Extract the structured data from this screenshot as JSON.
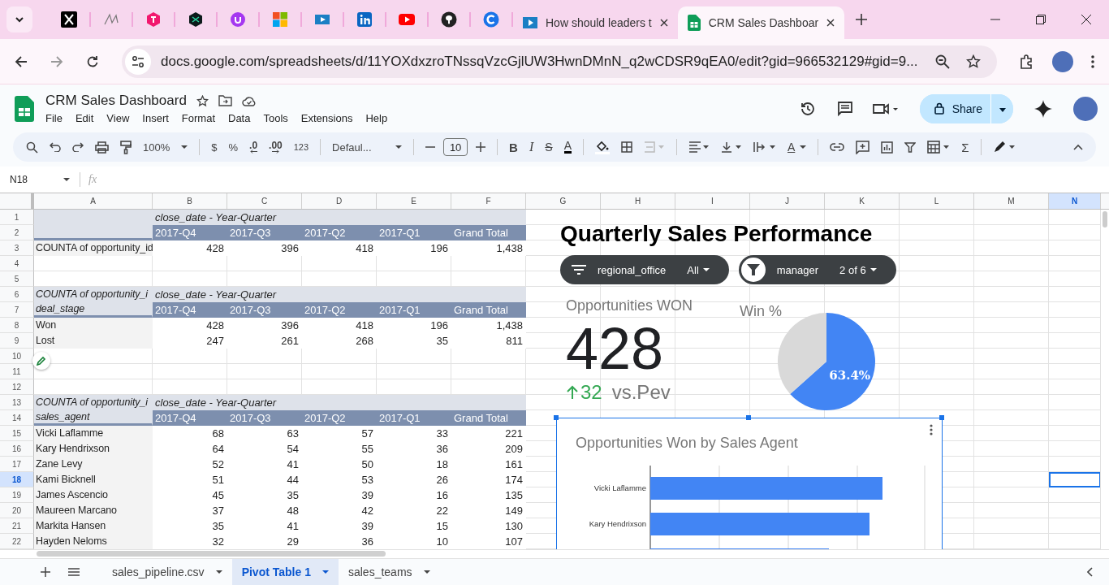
{
  "browser": {
    "tabs": [
      {
        "title": "How should leaders t",
        "selected": false
      },
      {
        "title": "CRM Sales Dashboar",
        "selected": true
      }
    ],
    "url": "docs.google.com/spreadsheets/d/11YOXdxzroTNssqVzcGjlUW3HwnDMnN_q2wCDSR9qEA0/edit?gid=966532129#gid=9..."
  },
  "document": {
    "title": "CRM Sales Dashboard",
    "menus": [
      "File",
      "Edit",
      "View",
      "Insert",
      "Format",
      "Data",
      "Tools",
      "Extensions",
      "Help"
    ],
    "share": "Share"
  },
  "toolbar": {
    "zoom": "100%",
    "currency": "$",
    "percent": "%",
    "decrease_decimals": ".0",
    "increase_decimals": ".00",
    "more_formats": "123",
    "font": "Defaul...",
    "font_size": "10",
    "bold": "B",
    "italic": "I",
    "strikethrough": "S",
    "text_color": "A",
    "text_rotation": "A",
    "functions": "Σ"
  },
  "formula_bar": {
    "cell": "N18",
    "fx": "fx"
  },
  "sheet": {
    "columns": [
      {
        "label": "A",
        "selected": false
      },
      {
        "label": "B",
        "selected": false
      },
      {
        "label": "C",
        "selected": false
      },
      {
        "label": "D",
        "selected": false
      },
      {
        "label": "E",
        "selected": false
      },
      {
        "label": "F",
        "selected": false
      },
      {
        "label": "G",
        "selected": false
      },
      {
        "label": "H",
        "selected": false
      },
      {
        "label": "I",
        "selected": false
      },
      {
        "label": "J",
        "selected": false
      },
      {
        "label": "K",
        "selected": false
      },
      {
        "label": "L",
        "selected": false
      },
      {
        "label": "M",
        "selected": false
      },
      {
        "label": "N",
        "selected": true
      }
    ],
    "rows": [
      {
        "number": "1",
        "selected": false,
        "kind": "caption",
        "caption": "close_date - Year-Quarter"
      },
      {
        "number": "2",
        "selected": false,
        "kind": "header",
        "values": [
          "2017-Q4",
          "2017-Q3",
          "2017-Q2",
          "2017-Q1",
          "Grand Total"
        ]
      },
      {
        "number": "3",
        "selected": false,
        "kind": "data",
        "label": "COUNTA of opportunity_id",
        "values": [
          "428",
          "396",
          "418",
          "196",
          "1,438"
        ]
      },
      {
        "number": "4",
        "selected": false,
        "kind": "blank"
      },
      {
        "number": "5",
        "selected": false,
        "kind": "blank"
      },
      {
        "number": "6",
        "selected": false,
        "kind": "caption",
        "label": "COUNTA of opportunity_i",
        "caption": "close_date - Year-Quarter"
      },
      {
        "number": "7",
        "selected": false,
        "kind": "header",
        "label": "deal_stage",
        "values": [
          "2017-Q4",
          "2017-Q3",
          "2017-Q2",
          "2017-Q1",
          "Grand Total"
        ]
      },
      {
        "number": "8",
        "selected": false,
        "kind": "data",
        "label": "Won",
        "values": [
          "428",
          "396",
          "418",
          "196",
          "1,438"
        ]
      },
      {
        "number": "9",
        "selected": false,
        "kind": "data",
        "label": "Lost",
        "values": [
          "247",
          "261",
          "268",
          "35",
          "811"
        ]
      },
      {
        "number": "10",
        "selected": false,
        "kind": "blank"
      },
      {
        "number": "11",
        "selected": false,
        "kind": "blank"
      },
      {
        "number": "12",
        "selected": false,
        "kind": "blank"
      },
      {
        "number": "13",
        "selected": false,
        "kind": "caption",
        "label": "COUNTA of opportunity_i",
        "caption": "close_date - Year-Quarter"
      },
      {
        "number": "14",
        "selected": false,
        "kind": "header",
        "label": "sales_agent",
        "values": [
          "2017-Q4",
          "2017-Q3",
          "2017-Q2",
          "2017-Q1",
          "Grand Total"
        ]
      },
      {
        "number": "15",
        "selected": false,
        "kind": "data",
        "label": "Vicki Laflamme",
        "values": [
          "68",
          "63",
          "57",
          "33",
          "221"
        ]
      },
      {
        "number": "16",
        "selected": false,
        "kind": "data",
        "label": "Kary Hendrixson",
        "values": [
          "64",
          "54",
          "55",
          "36",
          "209"
        ]
      },
      {
        "number": "17",
        "selected": false,
        "kind": "data",
        "label": "Zane Levy",
        "values": [
          "52",
          "41",
          "50",
          "18",
          "161"
        ]
      },
      {
        "number": "18",
        "selected": true,
        "kind": "data",
        "label": "Kami Bicknell",
        "values": [
          "51",
          "44",
          "53",
          "26",
          "174"
        ]
      },
      {
        "number": "19",
        "selected": false,
        "kind": "data",
        "label": "James Ascencio",
        "values": [
          "45",
          "35",
          "39",
          "16",
          "135"
        ]
      },
      {
        "number": "20",
        "selected": false,
        "kind": "data",
        "label": "Maureen Marcano",
        "values": [
          "37",
          "48",
          "42",
          "22",
          "149"
        ]
      },
      {
        "number": "21",
        "selected": false,
        "kind": "data",
        "label": "Markita Hansen",
        "values": [
          "35",
          "41",
          "39",
          "15",
          "130"
        ]
      },
      {
        "number": "22",
        "selected": false,
        "kind": "data",
        "label": "Hayden Neloms",
        "values": [
          "32",
          "29",
          "36",
          "10",
          "107"
        ]
      }
    ]
  },
  "dashboard": {
    "title": "Quarterly Sales Performance",
    "filters": [
      {
        "field": "regional_office",
        "value": "All",
        "active": false
      },
      {
        "field": "manager",
        "value": "2 of 6",
        "active": true
      }
    ],
    "scorecard": {
      "title": "Opportunities WON",
      "value": "428",
      "delta": "32",
      "positive": true,
      "comparison": "vs.Pev"
    },
    "pie": {
      "chart_data": {
        "type": "pie",
        "title": "Win %",
        "values": [
          63.4,
          36.6
        ],
        "value_labels": [
          "63.4%",
          null
        ]
      }
    },
    "bar_chart": {
      "title": "Opportunities Won by Sales Agent",
      "labels": [
        "Vicki Laflamme",
        "Kary Hendrixson"
      ],
      "selected": true
    }
  },
  "sheet_tabs": [
    {
      "label": "sales_pipeline.csv",
      "selected": false
    },
    {
      "label": "Pivot Table 1",
      "selected": true
    },
    {
      "label": "sales_teams",
      "selected": false
    }
  ]
}
